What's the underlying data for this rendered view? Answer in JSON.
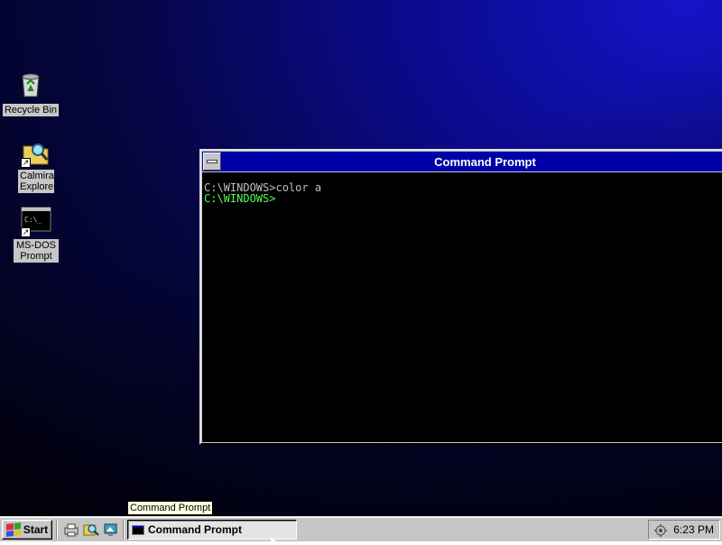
{
  "desktop": {
    "icons": [
      {
        "label": "Recycle Bin",
        "icon": "recycle-bin-icon"
      },
      {
        "label": "Calmira Explorer",
        "icon": "folder-search-icon"
      },
      {
        "label": "MS-DOS Prompt",
        "icon": "ms-dos-icon",
        "glyph_text": "C:\\_"
      }
    ]
  },
  "window": {
    "title": "Command Prompt",
    "console_lines": [
      "C:\\WINDOWS>color a",
      "C:\\WINDOWS>"
    ],
    "colors": {
      "titlebar": "#0000a8",
      "console_bg": "#000000",
      "text_default": "#c0c0c0",
      "text_green": "#55ff55"
    }
  },
  "tooltip": {
    "text": "Command Prompt"
  },
  "taskbar": {
    "start_label": "Start",
    "quick_launch": [
      "printer-icon",
      "search-icon",
      "desktop-icon"
    ],
    "tasks": [
      {
        "label": "Command Prompt",
        "icon": "console-icon",
        "active": true
      }
    ],
    "tray": {
      "icon": "tray-settings-icon",
      "clock": "6:23 PM"
    }
  }
}
